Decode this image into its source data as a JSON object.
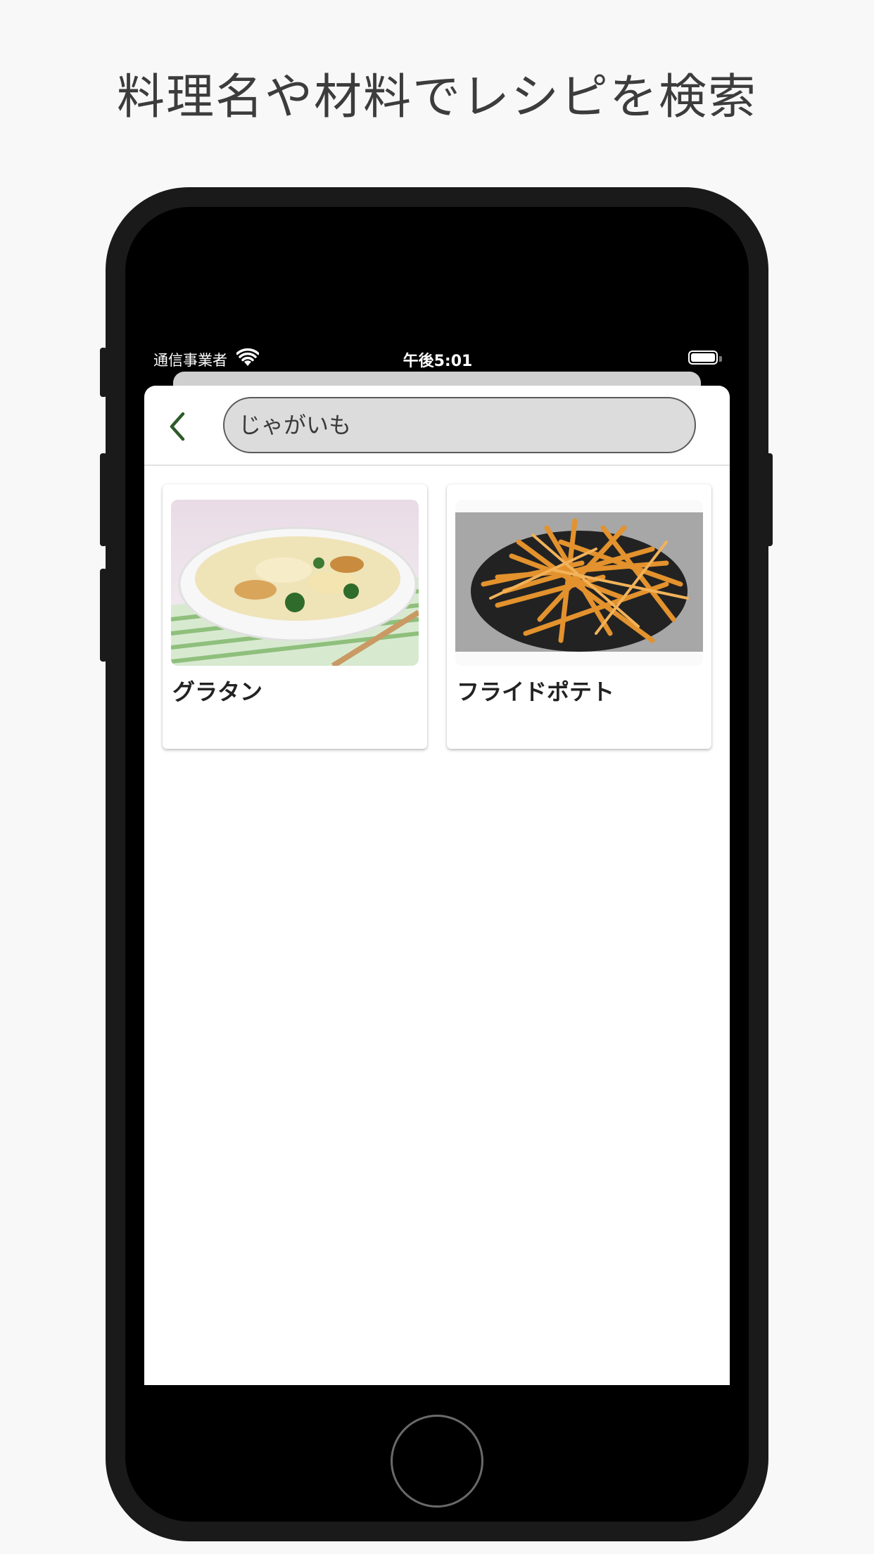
{
  "headline": "料理名や材料でレシピを検索",
  "status_bar": {
    "carrier": "通信事業者",
    "time": "午後5:01"
  },
  "search": {
    "query": "じゃがいも"
  },
  "results": [
    {
      "title": "グラタン",
      "image": "gratin-photo"
    },
    {
      "title": "フライドポテト",
      "image": "french-fries-photo"
    }
  ],
  "colors": {
    "back_arrow": "#2e5a2a",
    "search_bg": "#dcdcdc",
    "page_bg": "#f8f8f8"
  }
}
